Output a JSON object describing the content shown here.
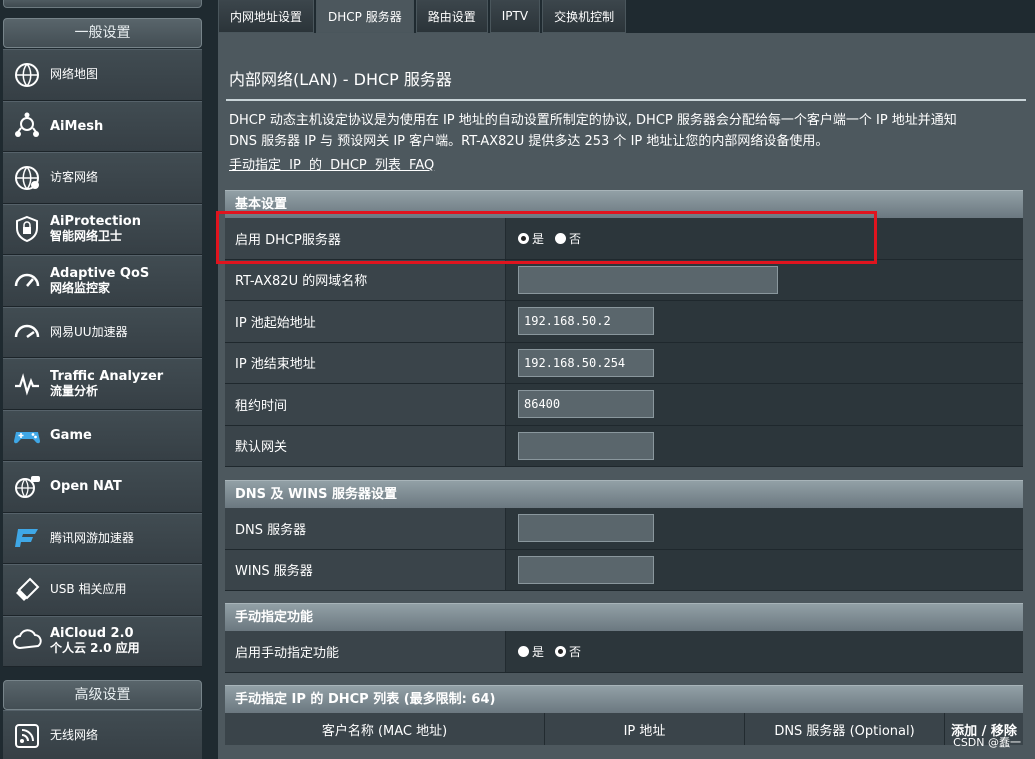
{
  "sidebar": {
    "general_header": "一般设置",
    "advanced_header": "高级设置",
    "items": [
      {
        "line1": "网络地图",
        "line2": "",
        "icon": "network-map-icon"
      },
      {
        "line1": "AiMesh",
        "line2": "",
        "icon": "aimesh-icon"
      },
      {
        "line1": "访客网络",
        "line2": "",
        "icon": "guest-network-icon"
      },
      {
        "line1": "AiProtection",
        "line2": "智能网络卫士",
        "icon": "aiprotection-icon"
      },
      {
        "line1": "Adaptive QoS",
        "line2": "网络监控家",
        "icon": "adaptive-qos-icon"
      },
      {
        "line1": "网易UU加速器",
        "line2": "",
        "icon": "uu-accelerator-icon"
      },
      {
        "line1": "Traffic Analyzer",
        "line2": "流量分析",
        "icon": "traffic-analyzer-icon"
      },
      {
        "line1": "Game",
        "line2": "",
        "icon": "gamepad-icon"
      },
      {
        "line1": "Open NAT",
        "line2": "",
        "icon": "open-nat-icon"
      },
      {
        "line1": "腾讯网游加速器",
        "line2": "",
        "icon": "tencent-accelerator-icon"
      },
      {
        "line1": "USB 相关应用",
        "line2": "",
        "icon": "usb-icon"
      },
      {
        "line1": "AiCloud 2.0",
        "line2": "个人云 2.0 应用",
        "icon": "aicloud-icon"
      }
    ],
    "advanced_items": [
      {
        "line1": "无线网络",
        "line2": "",
        "icon": "wireless-icon"
      }
    ]
  },
  "tabs": [
    {
      "label": "内网地址设置",
      "active": false
    },
    {
      "label": "DHCP 服务器",
      "active": true
    },
    {
      "label": "路由设置",
      "active": false
    },
    {
      "label": "IPTV",
      "active": false
    },
    {
      "label": "交换机控制",
      "active": false
    }
  ],
  "page": {
    "title": "内部网络(LAN) - DHCP 服务器",
    "desc_line1": "DHCP 动态主机设定协议是为使用在 IP 地址的自动设置所制定的协议, DHCP 服务器会分配给每一个客户端一个 IP 地址并通知",
    "desc_line2": "DNS 服务器 IP 与 预设网关 IP 客户端。RT-AX82U 提供多达 253 个 IP 地址让您的内部网络设备使用。",
    "faq_link": "手动指定 IP 的 DHCP 列表 FAQ"
  },
  "basic": {
    "header": "基本设置",
    "enable_dhcp_label": "启用 DHCP服务器",
    "enable_dhcp_yes": "是",
    "enable_dhcp_no": "否",
    "enable_dhcp_value": "是",
    "domain_label": "RT-AX82U 的网域名称",
    "domain_value": "",
    "pool_start_label": "IP 池起始地址",
    "pool_start_value": "192.168.50.2",
    "pool_end_label": "IP 池结束地址",
    "pool_end_value": "192.168.50.254",
    "lease_label": "租约时间",
    "lease_value": "86400",
    "gateway_label": "默认网关",
    "gateway_value": ""
  },
  "dns_wins": {
    "header": "DNS 及 WINS 服务器设置",
    "dns_label": "DNS 服务器",
    "dns_value": "",
    "wins_label": "WINS 服务器",
    "wins_value": ""
  },
  "manual": {
    "header": "手动指定功能",
    "enable_label": "启用手动指定功能",
    "yes": "是",
    "no": "否",
    "value": "否"
  },
  "manual_list": {
    "header": "手动指定 IP 的 DHCP 列表 (最多限制: 64)",
    "columns": [
      "客户名称 (MAC 地址)",
      "IP 地址",
      "DNS 服务器 (Optional)",
      "添加 / 移除"
    ]
  },
  "watermark": "CSDN @蠢一",
  "colors": {
    "highlight": "#e0141e",
    "panel": "#4d585e",
    "section_header": "#7f8c92"
  }
}
